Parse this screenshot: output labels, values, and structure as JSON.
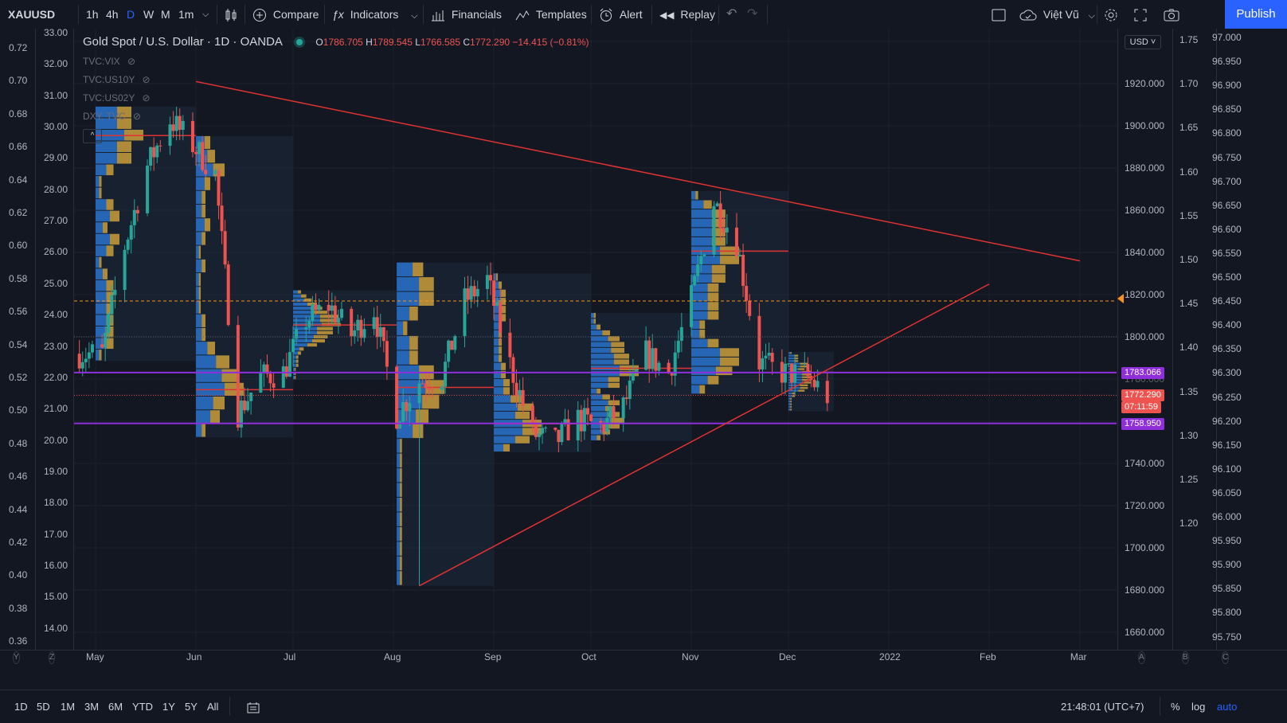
{
  "toolbar": {
    "symbol": "XAUUSD",
    "intervals": [
      "1h",
      "4h",
      "D",
      "W",
      "M",
      "1m"
    ],
    "active_interval": "D",
    "compare": "Compare",
    "indicators": "Indicators",
    "financials": "Financials",
    "templates": "Templates",
    "alert": "Alert",
    "replay": "Replay",
    "layout_name": "Việt Vũ",
    "publish": "Publish"
  },
  "legend": {
    "title": "Gold Spot / U.S. Dollar · 1D · OANDA",
    "o_label": "O",
    "o": "1786.705",
    "h_label": "H",
    "h": "1789.545",
    "l_label": "L",
    "l": "1766.585",
    "c_label": "C",
    "c": "1772.290",
    "change": "−14.415 (−0.81%)",
    "overlays": [
      "TVC:VIX",
      "TVC:US10Y",
      "TVC:US02Y",
      "DXY, TVC"
    ]
  },
  "currency": "USD",
  "colors": {
    "up": "#26a69a",
    "down": "#ef5350",
    "trendline": "#e03232",
    "level": "#8e2fdb",
    "volume_profile_up": "#2a78d6",
    "volume_profile_down": "#d4a53c",
    "alert_line": "#f7931a"
  },
  "axes": {
    "left_outer": [
      "0.72",
      "0.70",
      "0.68",
      "0.66",
      "0.64",
      "0.62",
      "0.60",
      "0.58",
      "0.56",
      "0.54",
      "0.52",
      "0.50",
      "0.48",
      "0.46",
      "0.44",
      "0.42",
      "0.40",
      "0.38",
      "0.36"
    ],
    "left_inner": [
      "33.00",
      "32.00",
      "31.00",
      "30.00",
      "29.00",
      "28.00",
      "27.00",
      "26.00",
      "25.00",
      "24.00",
      "23.00",
      "22.00",
      "21.00",
      "20.00",
      "19.00",
      "18.00",
      "17.00",
      "16.00",
      "15.00",
      "14.00"
    ],
    "price": [
      "1920.000",
      "1900.000",
      "1880.000",
      "1860.000",
      "1840.000",
      "1820.000",
      "1800.000",
      "1780.000",
      "1740.000",
      "1720.000",
      "1700.000",
      "1680.000",
      "1660.000"
    ],
    "right1": [
      "1.75",
      "1.70",
      "1.65",
      "1.60",
      "1.55",
      "1.50",
      "1.45",
      "1.40",
      "1.35",
      "1.30",
      "1.25",
      "1.20"
    ],
    "right2": [
      "97.000",
      "96.950",
      "96.900",
      "96.850",
      "96.800",
      "96.750",
      "96.700",
      "96.650",
      "96.600",
      "96.550",
      "96.500",
      "96.450",
      "96.400",
      "96.350",
      "96.300",
      "96.250",
      "96.200",
      "96.150",
      "96.100",
      "96.050",
      "96.000",
      "95.950",
      "95.900",
      "95.850",
      "95.800",
      "95.750"
    ],
    "months": [
      "May",
      "Jun",
      "Jul",
      "Aug",
      "Sep",
      "Oct",
      "Nov",
      "Dec",
      "2022",
      "Feb",
      "Mar"
    ],
    "corner_letters": [
      "Y",
      "Z",
      "A",
      "B",
      "C"
    ]
  },
  "price_tags": {
    "upper_level": "1783.066",
    "last_price": "1772.290",
    "countdown": "07:11:59",
    "lower_level": "1758.950"
  },
  "bottom": {
    "ranges": [
      "1D",
      "5D",
      "1M",
      "3M",
      "6M",
      "YTD",
      "1Y",
      "5Y",
      "All"
    ],
    "time": "21:48:01 (UTC+7)",
    "percent": "%",
    "log": "log",
    "auto": "auto"
  },
  "chart_data": {
    "type": "candlestick",
    "title": "Gold Spot / U.S. Dollar",
    "interval": "1D",
    "source": "OANDA",
    "x_range": [
      "2021-04-26",
      "2022-03-15"
    ],
    "y_range": [
      1655,
      1935
    ],
    "horizontal_levels": [
      1783.066,
      1758.95
    ],
    "alert_level": 1817,
    "trendlines": [
      {
        "from": [
          "2021-06-01",
          1921
        ],
        "to": [
          "2022-03-01",
          1836
        ]
      },
      {
        "from": [
          "2021-08-09",
          1682
        ],
        "to": [
          "2022-02-01",
          1825
        ]
      }
    ],
    "candles_close": [
      [
        "2021-05-03",
        1792
      ],
      [
        "2021-05-10",
        1843
      ],
      [
        "2021-05-17",
        1881
      ],
      [
        "2021-05-24",
        1903
      ],
      [
        "2021-05-31",
        1891
      ],
      [
        "2021-06-07",
        1877
      ],
      [
        "2021-06-14",
        1764
      ],
      [
        "2021-06-21",
        1781
      ],
      [
        "2021-06-28",
        1783
      ],
      [
        "2021-07-05",
        1808
      ],
      [
        "2021-07-12",
        1815
      ],
      [
        "2021-07-19",
        1801
      ],
      [
        "2021-07-26",
        1813
      ],
      [
        "2021-08-02",
        1763
      ],
      [
        "2021-08-09",
        1779
      ],
      [
        "2021-08-16",
        1781
      ],
      [
        "2021-08-23",
        1817
      ],
      [
        "2021-08-30",
        1827
      ],
      [
        "2021-09-06",
        1787
      ],
      [
        "2021-09-13",
        1754
      ],
      [
        "2021-09-20",
        1750
      ],
      [
        "2021-09-27",
        1761
      ],
      [
        "2021-10-04",
        1757
      ],
      [
        "2021-10-11",
        1767
      ],
      [
        "2021-10-18",
        1792
      ],
      [
        "2021-10-25",
        1783
      ],
      [
        "2021-11-01",
        1818
      ],
      [
        "2021-11-08",
        1864
      ],
      [
        "2021-11-15",
        1845
      ],
      [
        "2021-11-22",
        1788
      ],
      [
        "2021-11-29",
        1783
      ],
      [
        "2021-12-06",
        1782
      ],
      [
        "2021-12-13",
        1772
      ]
    ]
  }
}
